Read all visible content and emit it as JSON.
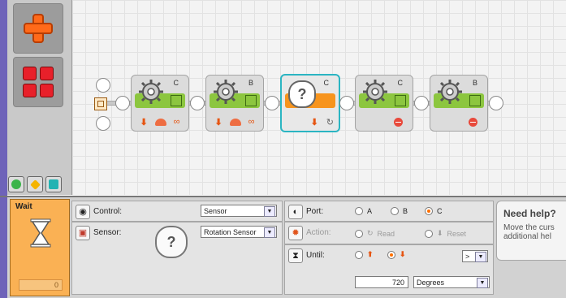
{
  "palette": {
    "buttons": [
      {
        "id": "common",
        "icon": "common-palette-cross-icon",
        "color": "#ff6a1a"
      },
      {
        "id": "complete",
        "icon": "complete-palette-grid-icon",
        "color": "#e8202a"
      }
    ],
    "tabs": [
      "green-circle",
      "yellow-diamond",
      "teal-square"
    ]
  },
  "program": {
    "blocks": [
      {
        "type": "motor",
        "port": "C",
        "icons": [
          "direction-down-icon",
          "power-icon",
          "duration-unlimited-icon"
        ]
      },
      {
        "type": "motor",
        "port": "B",
        "icons": [
          "direction-down-icon",
          "power-icon",
          "duration-unlimited-icon"
        ]
      },
      {
        "type": "wait-rotation-sensor",
        "port": "C",
        "selected": true,
        "icons": [
          "direction-down-icon",
          "rotation-icon"
        ]
      },
      {
        "type": "motor",
        "port": "C",
        "icons": [
          "stop-icon"
        ]
      },
      {
        "type": "motor",
        "port": "B",
        "icons": [
          "stop-icon"
        ]
      }
    ]
  },
  "panel": {
    "title": "Wait",
    "counter": "0",
    "control": {
      "label": "Control:",
      "value": "Sensor"
    },
    "sensor": {
      "label": "Sensor:",
      "value": "Rotation Sensor"
    },
    "port": {
      "label": "Port:",
      "options": [
        "A",
        "B",
        "C"
      ],
      "selected": "C"
    },
    "action": {
      "label": "Action:",
      "read": "Read",
      "reset": "Reset"
    },
    "until": {
      "label": "Until:",
      "comparison": ">",
      "value": "720",
      "unit": "Degrees"
    }
  },
  "help": {
    "title": "Need help?",
    "text": "Move the curs\nadditional hel"
  }
}
